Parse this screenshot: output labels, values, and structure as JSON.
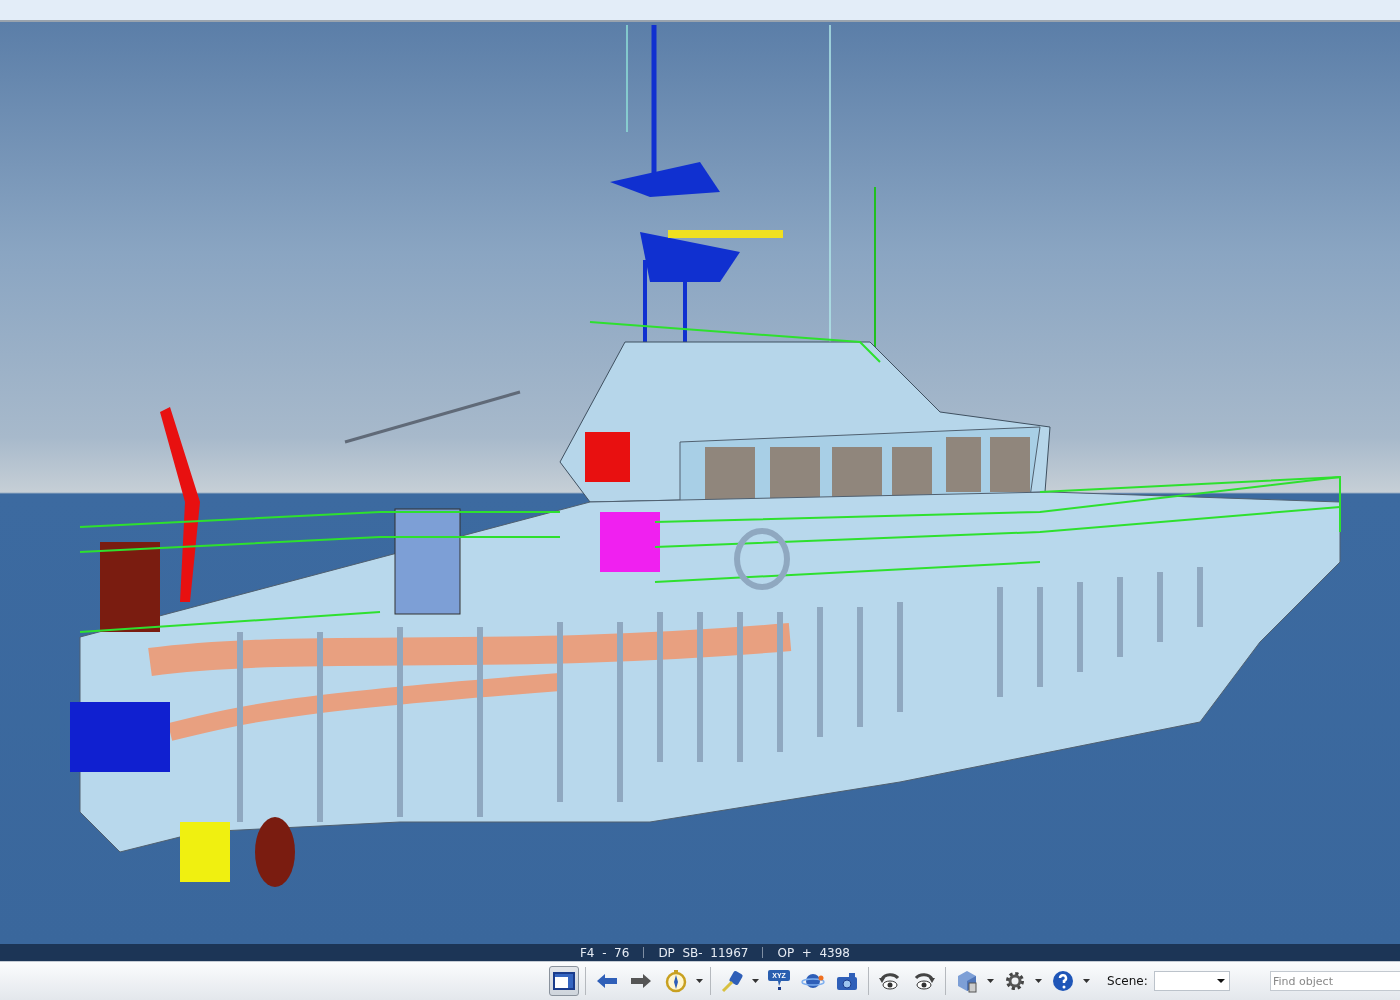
{
  "status_bar": {
    "items": [
      "F4  -  76",
      "DP  SB-  11967",
      "OP  +  4398"
    ]
  },
  "toolbar": {
    "groups": [
      [
        {
          "kind": "layout",
          "selected": true,
          "menu": false
        }
      ],
      [
        {
          "kind": "back",
          "selected": false,
          "menu": false
        },
        {
          "kind": "forward",
          "selected": false,
          "menu": false
        },
        {
          "kind": "compass",
          "selected": false,
          "menu": true
        }
      ],
      [
        {
          "kind": "measure",
          "selected": false,
          "menu": true
        },
        {
          "kind": "coordinates",
          "label": "XYZ",
          "selected": false,
          "menu": false
        },
        {
          "kind": "planet",
          "selected": false,
          "menu": false
        },
        {
          "kind": "camera",
          "selected": false,
          "menu": false
        }
      ],
      [
        {
          "kind": "rotate-left",
          "selected": false,
          "menu": false
        },
        {
          "kind": "rotate-right",
          "selected": false,
          "menu": false
        }
      ],
      [
        {
          "kind": "cube",
          "selected": false,
          "menu": true
        },
        {
          "kind": "gear",
          "selected": false,
          "menu": true
        },
        {
          "kind": "help",
          "selected": false,
          "menu": true
        }
      ]
    ],
    "scene": {
      "label": "Scene:"
    },
    "find": {
      "placeholder": "Find object"
    }
  }
}
